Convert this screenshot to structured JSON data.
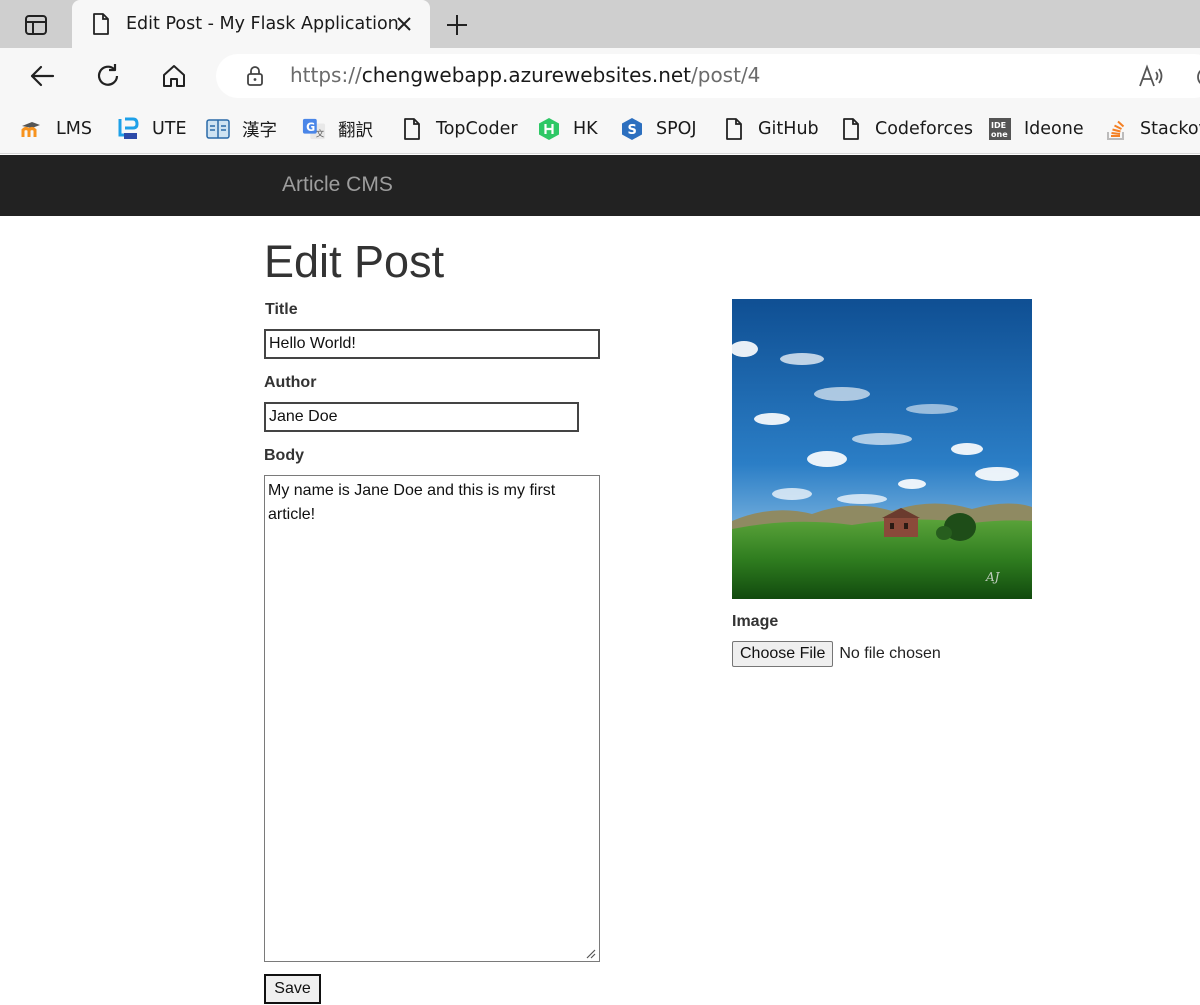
{
  "browser": {
    "tab": {
      "title": "Edit Post - My Flask Application",
      "icon": "page-icon"
    },
    "address": {
      "prefix": "https://",
      "host": "chengwebapp.azurewebsites.net",
      "path": "/post/4"
    },
    "bookmarks": [
      {
        "label": "LMS",
        "icon": "moodle-icon"
      },
      {
        "label": "UTE",
        "icon": "ute-icon"
      },
      {
        "label": "漢字",
        "icon": "kanji-dictionary-icon"
      },
      {
        "label": "翻訳",
        "icon": "translate-icon"
      },
      {
        "label": "TopCoder",
        "icon": "page-icon"
      },
      {
        "label": "HK",
        "icon": "hackerrank-icon"
      },
      {
        "label": "SPOJ",
        "icon": "spoj-icon"
      },
      {
        "label": "GitHub",
        "icon": "page-icon"
      },
      {
        "label": "Codeforces",
        "icon": "page-icon"
      },
      {
        "label": "Ideone",
        "icon": "ideone-icon"
      },
      {
        "label": "Stackov",
        "icon": "stackoverflow-icon"
      }
    ]
  },
  "navbar": {
    "brand": "Article CMS"
  },
  "form": {
    "heading": "Edit Post",
    "title_label": "Title",
    "title_value": "Hello World!",
    "author_label": "Author",
    "author_value": "Jane Doe",
    "body_label": "Body",
    "body_value": "My name is Jane Doe and this is my first article!",
    "image_label": "Image",
    "file_button": "Choose File",
    "file_status": "No file chosen",
    "save_label": "Save"
  },
  "colors": {
    "navbar_bg": "#222222",
    "brand": "#9d9d9d",
    "sky": "#1f6bb5",
    "grass": "#3d8a2a"
  }
}
